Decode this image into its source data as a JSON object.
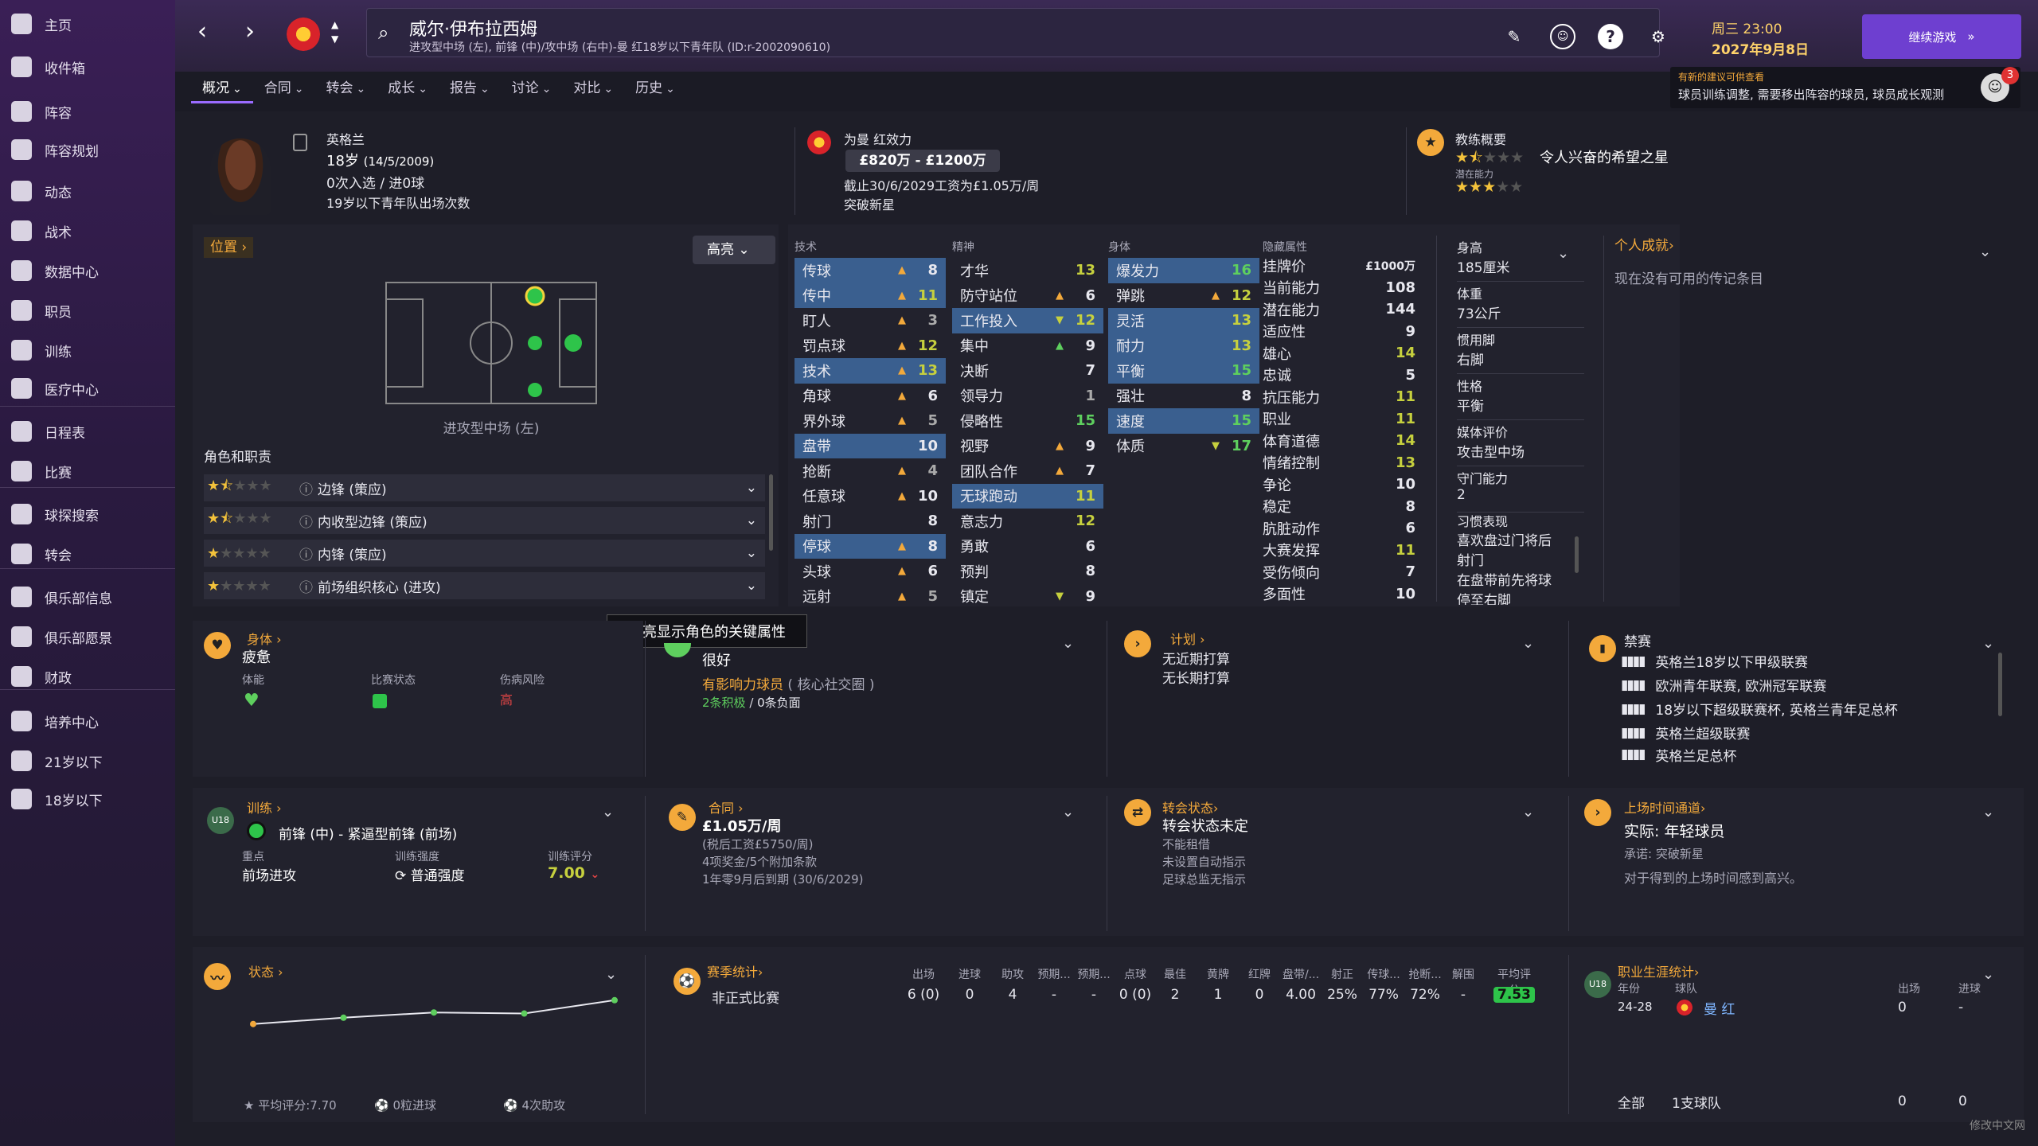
{
  "sidebar": {
    "items": [
      {
        "label": "主页",
        "icon": "home-icon"
      },
      {
        "label": "收件箱",
        "icon": "inbox-icon"
      },
      {
        "label": "阵容",
        "icon": "squad-icon"
      },
      {
        "label": "阵容规划",
        "icon": "planner-icon"
      },
      {
        "label": "动态",
        "icon": "dynamics-icon"
      },
      {
        "label": "战术",
        "icon": "tactics-icon"
      },
      {
        "label": "数据中心",
        "icon": "data-icon"
      },
      {
        "label": "职员",
        "icon": "staff-icon"
      },
      {
        "label": "训练",
        "icon": "training-icon"
      },
      {
        "label": "医疗中心",
        "icon": "medical-icon"
      },
      {
        "label": "日程表",
        "icon": "calendar-icon"
      },
      {
        "label": "比赛",
        "icon": "trophy-icon"
      },
      {
        "label": "球探搜索",
        "icon": "scout-icon"
      },
      {
        "label": "转会",
        "icon": "transfer-icon"
      },
      {
        "label": "俱乐部信息",
        "icon": "shield-icon"
      },
      {
        "label": "俱乐部愿景",
        "icon": "vision-icon"
      },
      {
        "label": "财政",
        "icon": "finance-icon"
      },
      {
        "label": "培养中心",
        "icon": "development-icon"
      },
      {
        "label": "21岁以下",
        "icon": "u21-icon"
      },
      {
        "label": "18岁以下",
        "icon": "u18-icon"
      }
    ]
  },
  "header": {
    "player_name": "威尔·伊布拉西姆",
    "player_sub": "进攻型中场 (左), 前锋 (中)/攻中场 (右中)-曼 红18岁以下青年队 (ID:r-2002090610)",
    "day_time": "周三 23:00",
    "date": "2027年9月8日",
    "continue_label": "继续游戏",
    "continue_icon": "double-chevron-icon"
  },
  "tabs": [
    "概况",
    "合同",
    "转会",
    "成长",
    "报告",
    "讨论",
    "对比",
    "历史"
  ],
  "notice": {
    "title": "有新的建议可供查看",
    "text": "球员训练调整, 需要移出阵容的球员, 球员成长观测",
    "count": "3"
  },
  "profile": {
    "nation": "英格兰",
    "age": "18岁",
    "dob": "(14/5/2009)",
    "caps": "0次入选 / 进0球",
    "youth": "19岁以下青年队出场次数",
    "club_label": "为曼 红效力",
    "value": "£820万 - £1200万",
    "contract": "截止30/6/2029工资为£1.05万/周",
    "status": "突破新星",
    "coach_label": "教练概要",
    "coach_text": "令人兴奋的希望之星",
    "potential_label": "潜在能力"
  },
  "position": {
    "link": "位置",
    "highlight": "高亮",
    "name": "进攻型中场 (左)",
    "roles_label": "角色和职责",
    "roles": [
      {
        "stars": "1.5",
        "label": "边锋 (策应)"
      },
      {
        "stars": "1.5",
        "label": "内收型边锋 (策应)"
      },
      {
        "stars": "1",
        "label": "内锋 (策应)"
      },
      {
        "stars": "1",
        "label": "前场组织核心 (进攻)"
      }
    ]
  },
  "attrs": {
    "tech_label": "技术",
    "mental_label": "精神",
    "phys_label": "身体",
    "hidden_label": "隐藏属性",
    "technical": [
      {
        "n": "传球",
        "v": "8",
        "hl": true,
        "a": "up"
      },
      {
        "n": "传中",
        "v": "11",
        "hl": true,
        "a": "up"
      },
      {
        "n": "盯人",
        "v": "3",
        "a": "up"
      },
      {
        "n": "罚点球",
        "v": "12",
        "a": "up"
      },
      {
        "n": "技术",
        "v": "13",
        "hl": true,
        "a": "up"
      },
      {
        "n": "角球",
        "v": "6",
        "a": "up"
      },
      {
        "n": "界外球",
        "v": "5",
        "a": "up"
      },
      {
        "n": "盘带",
        "v": "10",
        "hl": true
      },
      {
        "n": "抢断",
        "v": "4",
        "a": "up"
      },
      {
        "n": "任意球",
        "v": "10",
        "a": "up"
      },
      {
        "n": "射门",
        "v": "8"
      },
      {
        "n": "停球",
        "v": "8",
        "hl": true,
        "a": "up"
      },
      {
        "n": "头球",
        "v": "6",
        "a": "up"
      },
      {
        "n": "远射",
        "v": "5",
        "a": "up"
      }
    ],
    "mental": [
      {
        "n": "才华",
        "v": "13"
      },
      {
        "n": "防守站位",
        "v": "6",
        "a": "up"
      },
      {
        "n": "工作投入",
        "v": "12",
        "hl": true,
        "a": "dn"
      },
      {
        "n": "集中",
        "v": "9",
        "a": "upg"
      },
      {
        "n": "决断",
        "v": "7"
      },
      {
        "n": "领导力",
        "v": "1"
      },
      {
        "n": "侵略性",
        "v": "15"
      },
      {
        "n": "视野",
        "v": "9",
        "a": "up"
      },
      {
        "n": "团队合作",
        "v": "7",
        "a": "up"
      },
      {
        "n": "无球跑动",
        "v": "11",
        "hl": true
      },
      {
        "n": "意志力",
        "v": "12"
      },
      {
        "n": "勇敢",
        "v": "6"
      },
      {
        "n": "预判",
        "v": "8"
      },
      {
        "n": "镇定",
        "v": "9",
        "a": "dn"
      }
    ],
    "physical": [
      {
        "n": "爆发力",
        "v": "16",
        "hl": true
      },
      {
        "n": "弹跳",
        "v": "12",
        "a": "up"
      },
      {
        "n": "灵活",
        "v": "13",
        "hl": true
      },
      {
        "n": "耐力",
        "v": "13",
        "hl": true
      },
      {
        "n": "平衡",
        "v": "15",
        "hl": true
      },
      {
        "n": "强壮",
        "v": "8"
      },
      {
        "n": "速度",
        "v": "15",
        "hl": true
      },
      {
        "n": "体质",
        "v": "17",
        "a": "dn"
      }
    ],
    "hidden": [
      {
        "n": "挂牌价",
        "v": "£1000万"
      },
      {
        "n": "当前能力",
        "v": "108"
      },
      {
        "n": "潜在能力",
        "v": "144"
      },
      {
        "n": "适应性",
        "v": "9"
      },
      {
        "n": "雄心",
        "v": "14"
      },
      {
        "n": "忠诚",
        "v": "5"
      },
      {
        "n": "抗压能力",
        "v": "11"
      },
      {
        "n": "职业",
        "v": "11"
      },
      {
        "n": "体育道德",
        "v": "14"
      },
      {
        "n": "情绪控制",
        "v": "13"
      },
      {
        "n": "争论",
        "v": "10"
      },
      {
        "n": "稳定",
        "v": "8"
      },
      {
        "n": "肮脏动作",
        "v": "6"
      },
      {
        "n": "大赛发挥",
        "v": "11"
      },
      {
        "n": "受伤倾向",
        "v": "7"
      },
      {
        "n": "多面性",
        "v": "10"
      }
    ]
  },
  "info": [
    {
      "k": "身高",
      "v": "185厘米"
    },
    {
      "k": "体重",
      "v": "73公斤"
    },
    {
      "k": "惯用脚",
      "v": "右脚"
    },
    {
      "k": "性格",
      "v": "平衡"
    },
    {
      "k": "媒体评价",
      "v": "攻击型中场"
    },
    {
      "k": "守门能力",
      "v": "2"
    }
  ],
  "habits": {
    "label": "习惯表现",
    "lines": [
      "喜欢盘过门将后",
      "射门",
      "在盘带前先将球",
      "停至右脚"
    ]
  },
  "achievements": {
    "link": "个人成就",
    "empty": "现在没有可用的传记条目"
  },
  "tooltip": "高亮显示角色的关键属性",
  "body": {
    "link": "身体",
    "state": "疲惫",
    "fitness": "体能",
    "match": "比赛状态",
    "injury": "伤病风险",
    "injury_val": "高"
  },
  "morale": {
    "state": "很好",
    "role": "有影响力球员",
    "role2": "( 核心社交圈 )",
    "pos": "2条积极",
    "neg": "0条负面"
  },
  "plan": {
    "link": "计划",
    "l1": "无近期打算",
    "l2": "无长期打算"
  },
  "bans": {
    "title": "禁赛",
    "comps": [
      "英格兰18岁以下甲级联赛",
      "欧洲青年联赛, 欧洲冠军联赛",
      "18岁以下超级联赛杯, 英格兰青年足总杯",
      "英格兰超级联赛",
      "英格兰足总杯"
    ]
  },
  "training": {
    "link": "训练",
    "focus": "前锋 (中) - 紧逼型前锋 (前场)",
    "emph_label": "重点",
    "emph": "前场进攻",
    "int_label": "训练强度",
    "int": "普通强度",
    "rate_label": "训练评分",
    "rate": "7.00"
  },
  "contract": {
    "link": "合同",
    "wage": "£1.05万/周",
    "tax": "(税后工资£5750/周)",
    "bonus": "4项奖金/5个附加条款",
    "expiry": "1年零9月后到期 (30/6/2029)"
  },
  "transfer": {
    "link": "转会状态",
    "state": "转会状态未定",
    "l1": "不能租借",
    "l2": "未设置自动指示",
    "l3": "足球总监无指示"
  },
  "playtime": {
    "link": "上场时间通道",
    "actual": "实际: 年轻球员",
    "promise": "承诺: 突破新星",
    "desc": "对于得到的上场时间感到高兴。"
  },
  "form": {
    "link": "状态",
    "avg": "平均评分:7.70",
    "goals": "0粒进球",
    "assists": "4次助攻",
    "points": [
      0.12,
      0.3,
      0.45,
      0.42,
      0.8
    ]
  },
  "season": {
    "link": "赛季统计",
    "headers": [
      "出场",
      "进球",
      "助攻",
      "预期...",
      "预期...",
      "点球",
      "最佳",
      "黄牌",
      "红牌",
      "盘带/...",
      "射正",
      "传球...",
      "抢断...",
      "解围",
      "平均评分"
    ],
    "row_label": "非正式比赛",
    "values": [
      "6 (0)",
      "0",
      "4",
      "-",
      "-",
      "0 (0)",
      "2",
      "1",
      "0",
      "4.00",
      "25%",
      "77%",
      "72%",
      "-",
      "7.53"
    ]
  },
  "career": {
    "link": "职业生涯统计",
    "h_year": "年份",
    "h_team": "球队",
    "h_apps": "出场",
    "h_goals": "进球",
    "year": "24-28",
    "team": "曼 红",
    "apps": "0",
    "goals": "-",
    "total": "全部",
    "total_team": "1支球队",
    "total_apps": "0",
    "total_goals": "0"
  },
  "watermark": "修改中文网",
  "colors": {
    "accent": "#f3a93b",
    "highlight": "#3a5f8f",
    "purple": "#6e3fd0",
    "green": "#5ecf5e"
  }
}
